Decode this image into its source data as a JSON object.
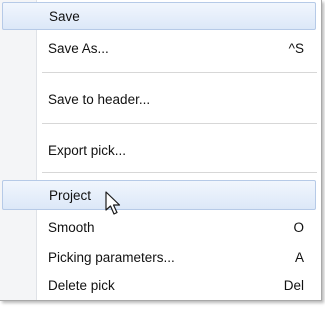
{
  "menu": {
    "items": [
      {
        "label": "Save",
        "shortcut": ""
      },
      {
        "label": "Save As...",
        "shortcut": "^S"
      },
      {
        "label": "Save to header...",
        "shortcut": ""
      },
      {
        "label": "Export pick...",
        "shortcut": ""
      },
      {
        "label": "Project",
        "shortcut": ""
      },
      {
        "label": "Smooth",
        "shortcut": "O"
      },
      {
        "label": "Picking parameters...",
        "shortcut": "A"
      },
      {
        "label": "Delete pick",
        "shortcut": "Del"
      }
    ]
  },
  "colors": {
    "highlight": "#dce8f8",
    "highlight_border": "#b6cae7",
    "gutter": "#f4f5f7",
    "separator": "#d7d7d7"
  },
  "cursor": {
    "icon": "arrow-pointer-icon"
  }
}
